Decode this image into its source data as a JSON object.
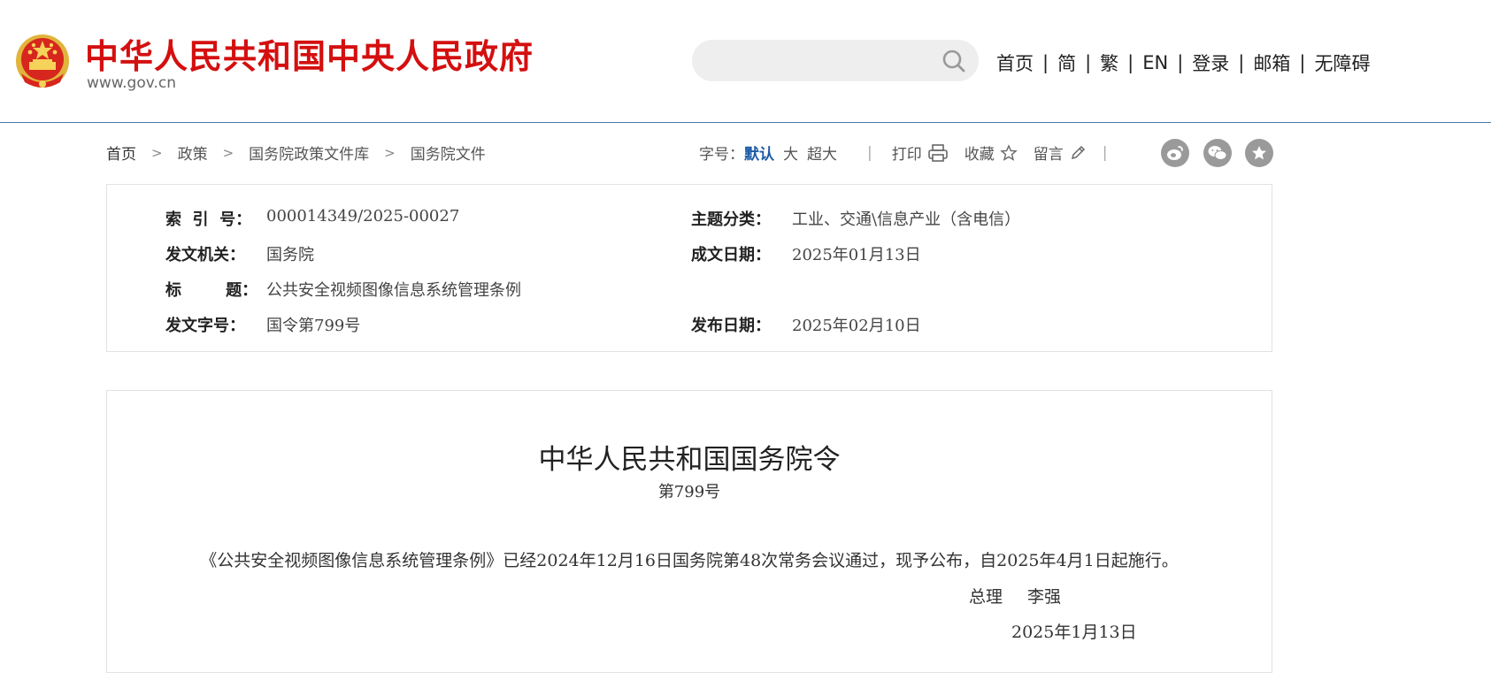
{
  "header": {
    "site_title": "中华人民共和国中央人民政府",
    "site_domain": "www.gov.cn",
    "search": {
      "placeholder": ""
    },
    "nav": [
      {
        "label": "首页"
      },
      {
        "label": "简"
      },
      {
        "label": "繁"
      },
      {
        "label": "EN"
      },
      {
        "label": "登录"
      },
      {
        "label": "邮箱"
      },
      {
        "label": "无障碍"
      }
    ],
    "nav_separator": "|"
  },
  "breadcrumb": [
    "首页",
    "政策",
    "国务院政策文件库",
    "国务院文件"
  ],
  "tools": {
    "font_label": "字号：",
    "font_default": "默认",
    "font_large": "大",
    "font_xlarge": "超大",
    "print": "打印",
    "favorite": "收藏",
    "comment": "留言",
    "separator": "|"
  },
  "share_icons": [
    "weibo-icon",
    "wechat-icon",
    "party-icon"
  ],
  "info": {
    "index_label": "索  引  号：",
    "index_value": "000014349/2025-00027",
    "topic_label": "主题分类：",
    "topic_value": "工业、交通\\信息产业（含电信）",
    "issuer_label": "发文机关：",
    "issuer_value": "国务院",
    "created_label": "成文日期：",
    "created_value": "2025年01月13日",
    "title_label": "标        题：",
    "title_value": "公共安全视频图像信息系统管理条例",
    "docno_label": "发文字号：",
    "docno_value": "国令第799号",
    "published_label": "发布日期：",
    "published_value": "2025年02月10日"
  },
  "document": {
    "title": "中华人民共和国国务院令",
    "number": "第799号",
    "body": "《公共安全视频图像信息系统管理条例》已经2024年12月16日国务院第48次常务会议通过，现予公布，自2025年4月1日起施行。",
    "signer_title": "总理",
    "signer_name": "李强",
    "date": "2025年1月13日"
  },
  "colors": {
    "brand_red": "#d40f0f",
    "accent_blue": "#1c5aa6",
    "header_rule": "#4f7aa8"
  }
}
